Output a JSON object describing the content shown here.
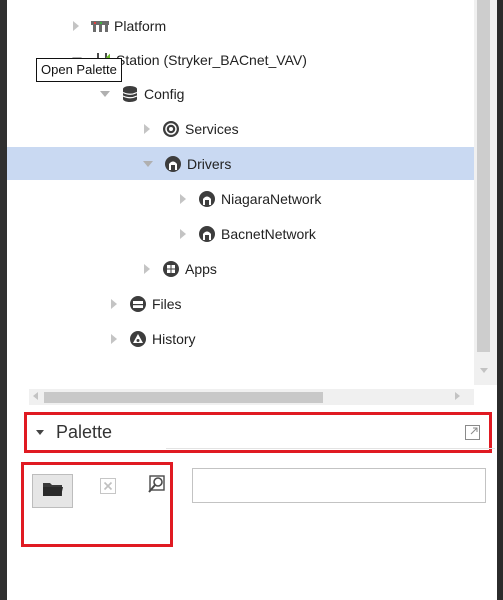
{
  "tree": {
    "items": [
      {
        "label": "Platform",
        "icon": "platform-icon",
        "state": "collapsed"
      },
      {
        "label": "Station (Stryker_BACnet_VAV)",
        "icon": "station-icon",
        "state": "expanded"
      },
      {
        "label": "Config",
        "icon": "config-database-icon",
        "state": "expanded"
      },
      {
        "label": "Services",
        "icon": "services-icon",
        "state": "collapsed"
      },
      {
        "label": "Drivers",
        "icon": "drivers-icon",
        "state": "expanded",
        "selected": true
      },
      {
        "label": "NiagaraNetwork",
        "icon": "niagara-network-icon",
        "state": "collapsed"
      },
      {
        "label": "BacnetNetwork",
        "icon": "bacnet-network-icon",
        "state": "collapsed"
      },
      {
        "label": "Apps",
        "icon": "apps-icon",
        "state": "collapsed"
      },
      {
        "label": "Files",
        "icon": "files-icon",
        "state": "collapsed"
      },
      {
        "label": "History",
        "icon": "history-icon",
        "state": "collapsed"
      }
    ]
  },
  "palette": {
    "title": "Palette",
    "open_tooltip": "Open Palette",
    "search_value": ""
  },
  "colors": {
    "selection": "#c9d9f2",
    "highlight_border": "#e01a22",
    "frame": "#303030"
  }
}
